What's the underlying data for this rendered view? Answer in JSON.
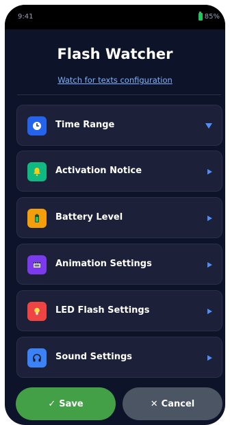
{
  "status_bar": {
    "time": "9:41",
    "battery": "85%"
  },
  "header": {
    "title": "Flash Watcher",
    "subtitle": "Watch for texts configuration"
  },
  "settings": [
    {
      "label": "Time Range",
      "icon": "clock-icon",
      "color": "#2563eb",
      "chevron": "down"
    },
    {
      "label": "Activation Notice",
      "icon": "bell-icon",
      "color": "#10b981",
      "chevron": "right"
    },
    {
      "label": "Battery Level",
      "icon": "battery-icon",
      "color": "#f59e0b",
      "chevron": "right"
    },
    {
      "label": "Animation Settings",
      "icon": "film-icon",
      "color": "#7c3aed",
      "chevron": "right"
    },
    {
      "label": "LED Flash Settings",
      "icon": "lightbulb-icon",
      "color": "#ef4444",
      "chevron": "right"
    },
    {
      "label": "Sound Settings",
      "icon": "headphones-icon",
      "color": "#3b82f6",
      "chevron": "right"
    }
  ],
  "actions": {
    "save_label": "Save",
    "cancel_label": "Cancel"
  }
}
